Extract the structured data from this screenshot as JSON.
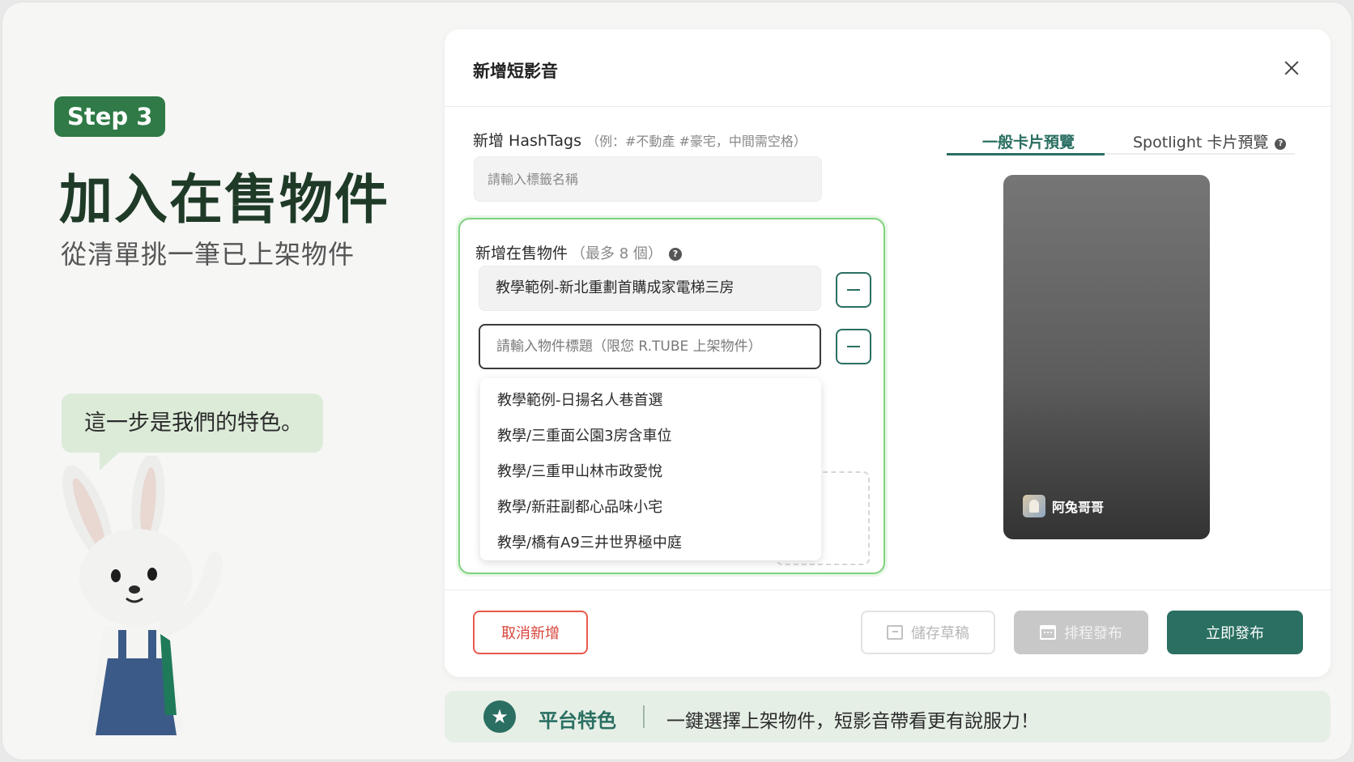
{
  "hero": {
    "step_badge": "Step 3",
    "title": "加入在售物件",
    "subtitle": "從清單挑一筆已上架物件",
    "bubble": "這一步是我們的特色。"
  },
  "modal": {
    "title": "新增短影音",
    "hashtags": {
      "label": "新增 HashTags",
      "hint": "（例：#不動產 #豪宅，中間需空格）",
      "placeholder": "請輸入標籤名稱"
    },
    "listings": {
      "label": "新增在售物件",
      "hint": "（最多 8 個）",
      "help_symbol": "?",
      "selected": "教學範例-新北重劃首購成家電梯三房",
      "input_placeholder": "請輸入物件標題（限您 R.TUBE 上架物件）",
      "dropdown_items": [
        "教學範例-日揚名人巷首選",
        "教學/三重面公園3房含車位",
        "教學/三重甲山林市政愛悅",
        "教學/新莊副都心品味小宅",
        "教學/橋有A9三井世界極中庭"
      ]
    },
    "preview": {
      "tabs": [
        {
          "label": "一般卡片預覽",
          "active": true
        },
        {
          "label": "Spotlight 卡片預覽",
          "active": false
        }
      ],
      "help_symbol": "?",
      "author": "阿兔哥哥"
    },
    "footer": {
      "cancel": "取消新增",
      "draft": "儲存草稿",
      "schedule": "排程發布",
      "publish": "立即發布"
    }
  },
  "banner": {
    "title": "平台特色",
    "text": "一鍵選擇上架物件，短影音帶看更有說服力！"
  },
  "colors": {
    "brand_green": "#2a6f62",
    "badge_green": "#2f7a46",
    "highlight_border": "#7ed27e",
    "cancel_red": "#e8594d"
  },
  "icons": {
    "close": "close-icon",
    "help": "help-icon",
    "minus": "minus-icon",
    "draft": "archive-icon",
    "schedule": "calendar-icon",
    "banner": "star-icon"
  }
}
